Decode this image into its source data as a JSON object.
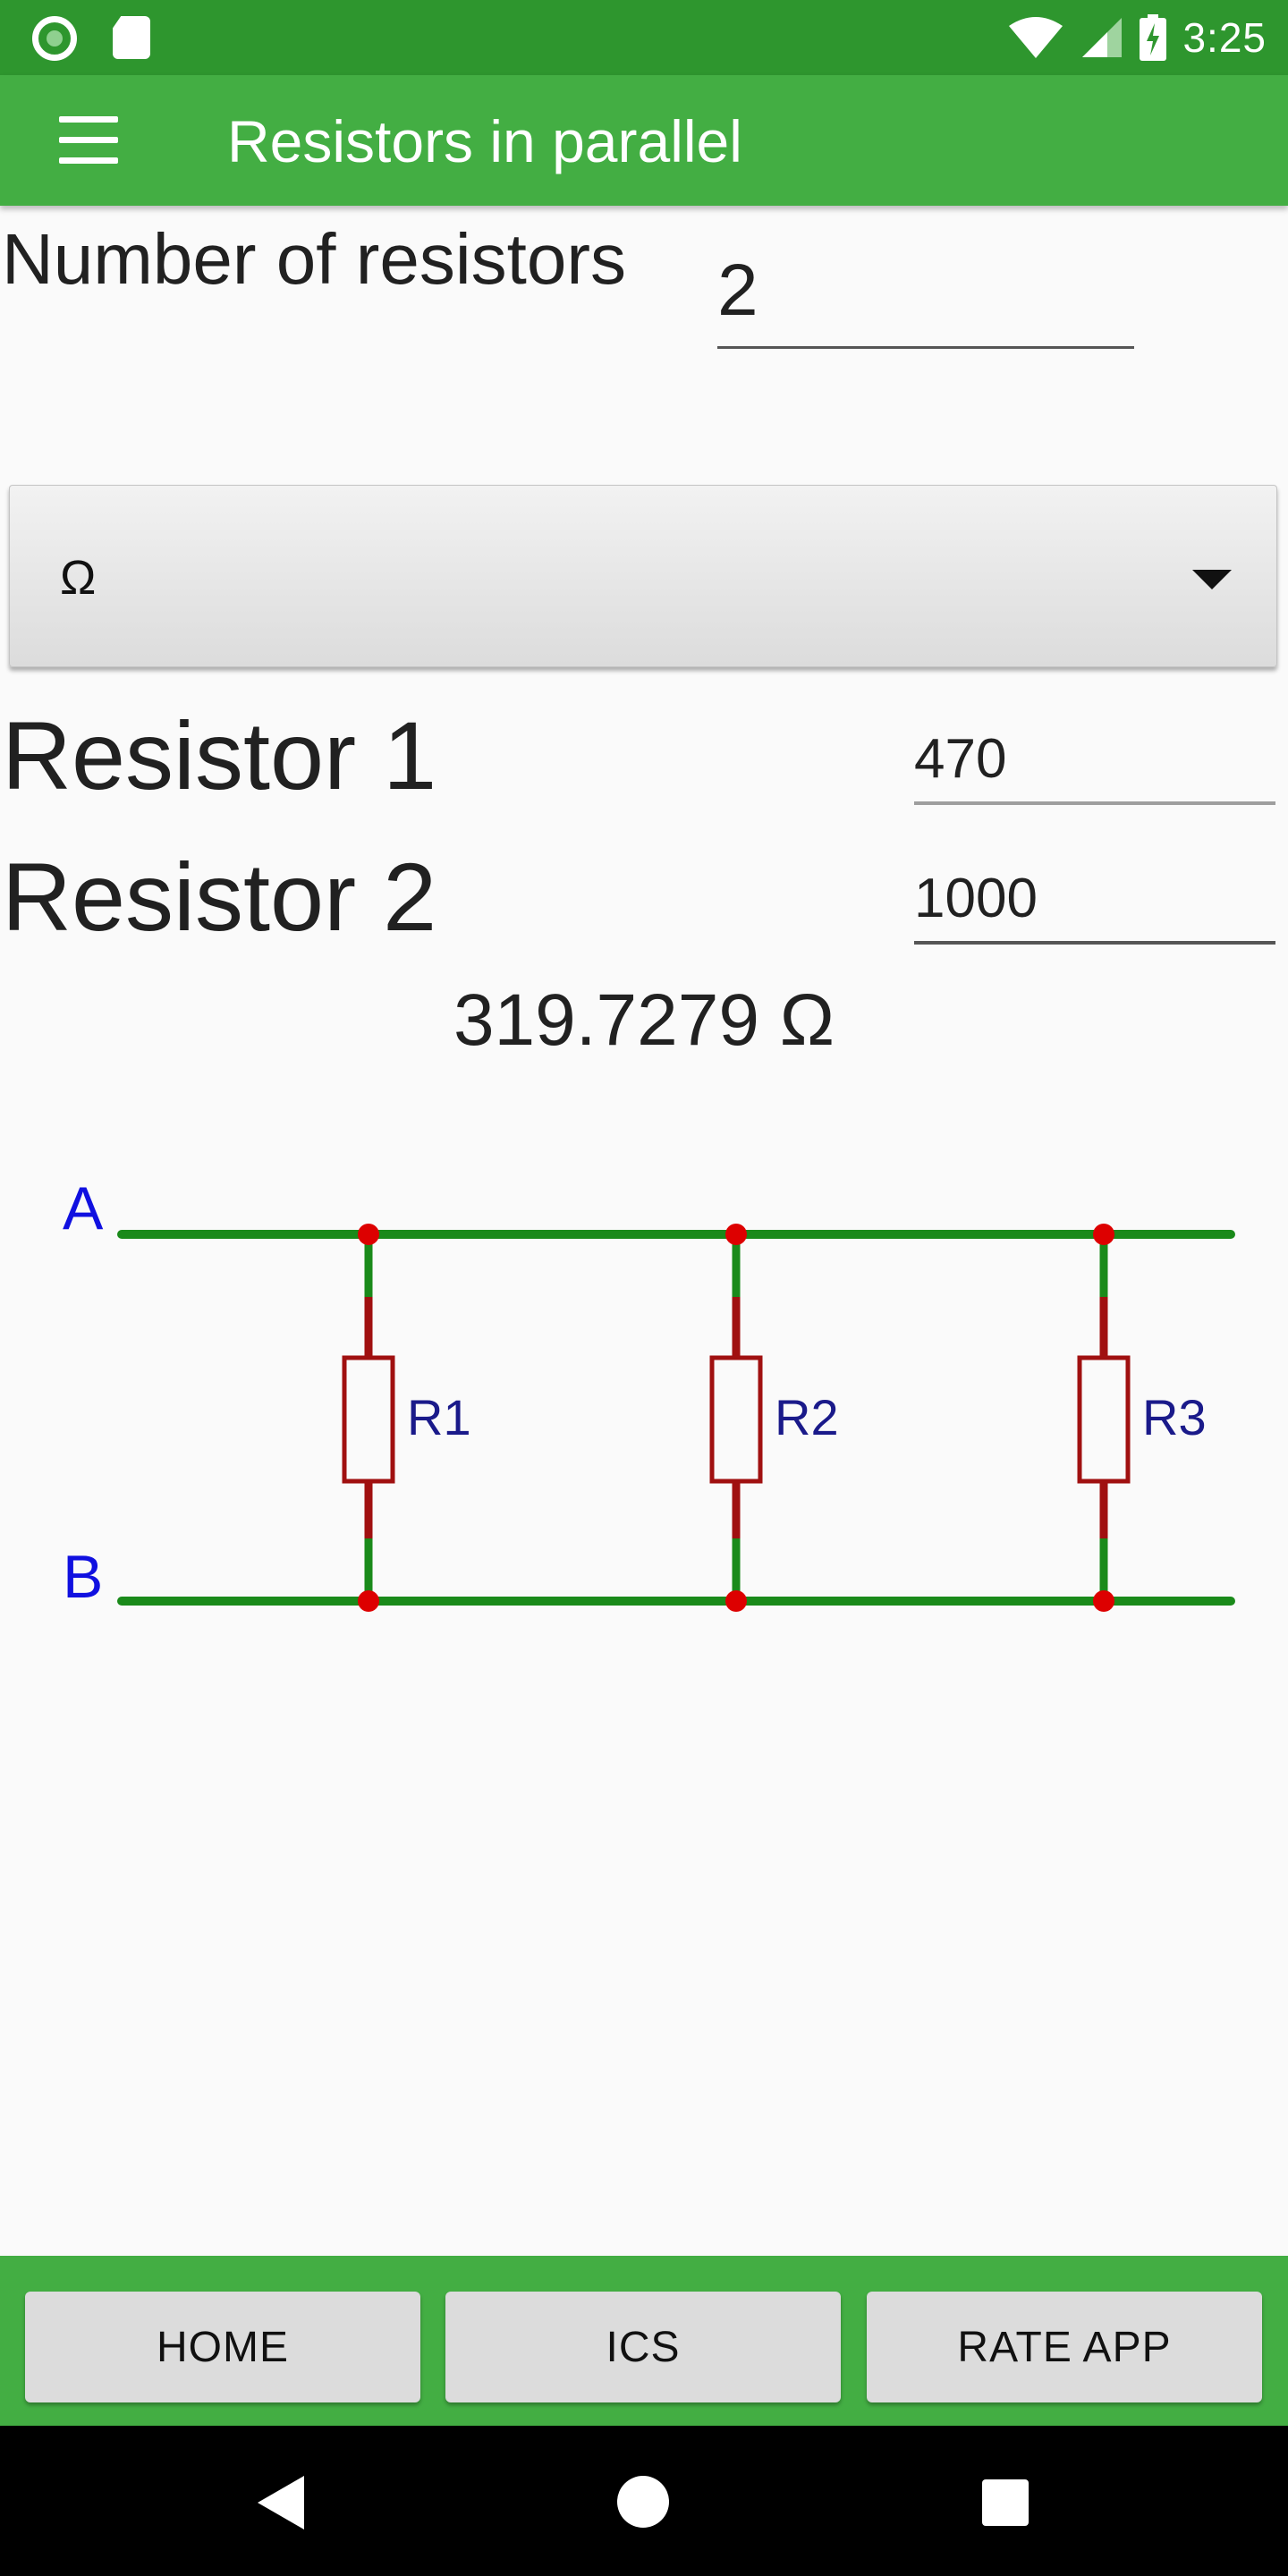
{
  "status_bar": {
    "time": "3:25",
    "left_icons": [
      "record-icon",
      "sd-card-icon"
    ],
    "right_icons": [
      "wifi-icon",
      "signal-icon",
      "battery-charging-icon"
    ]
  },
  "app_bar": {
    "title": "Resistors in parallel",
    "menu_icon": "hamburger-menu-icon",
    "color": "#43ae43"
  },
  "form": {
    "number_label": "Number of resistors",
    "number_value": "2",
    "unit_selected": "Ω",
    "resistors": [
      {
        "label": "Resistor 1",
        "value": "470"
      },
      {
        "label": "Resistor 2",
        "value": "1000"
      }
    ],
    "result": "319.7279 Ω"
  },
  "circuit": {
    "node_a": "A",
    "node_b": "B",
    "resistors": [
      "R1",
      "R2",
      "R3"
    ],
    "wire_color": "#1a8a1a",
    "resistor_color": "#a01010",
    "label_color": "#1a1a8a",
    "node_label_color": "#1010e0"
  },
  "bottom_bar": {
    "buttons": [
      "HOME",
      "ICS",
      "RATE APP"
    ]
  },
  "nav_bar": {
    "icons": [
      "back-icon",
      "home-icon",
      "recents-icon"
    ]
  }
}
